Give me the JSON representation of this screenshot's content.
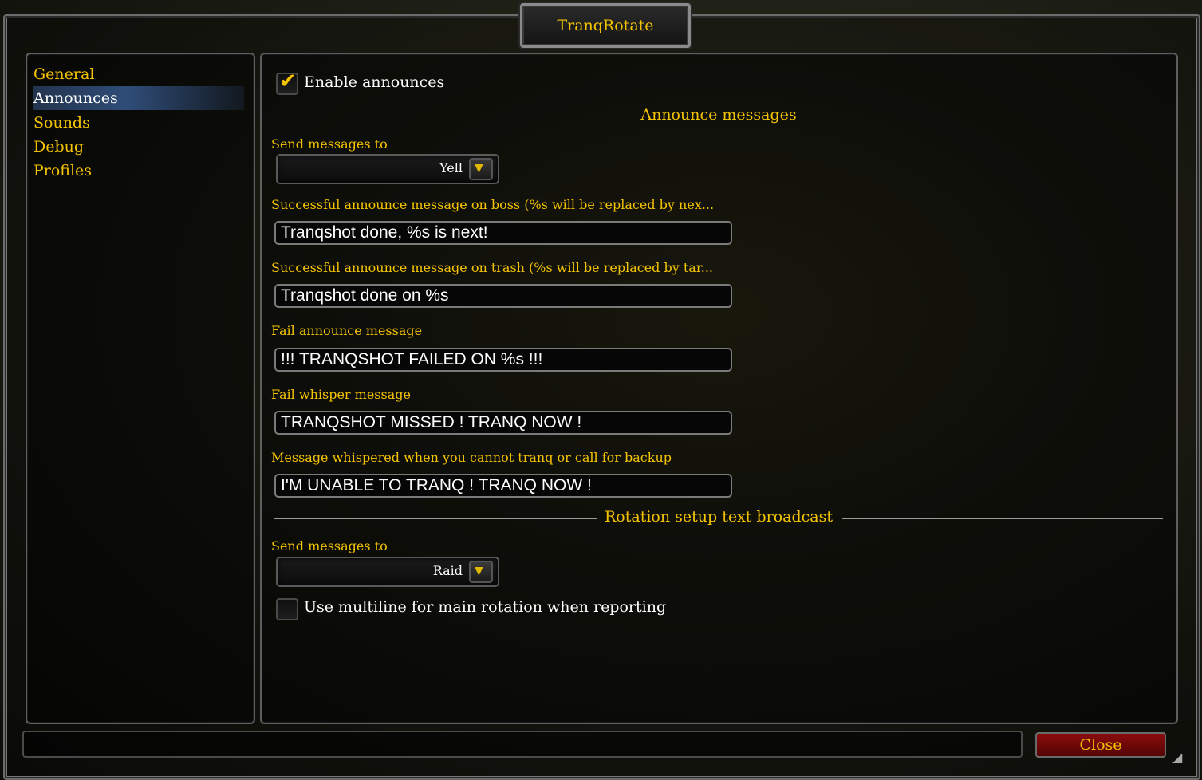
{
  "window": {
    "title": "TranqRotate"
  },
  "sidebar": {
    "items": [
      {
        "label": "General"
      },
      {
        "label": "Announces"
      },
      {
        "label": "Sounds"
      },
      {
        "label": "Debug"
      },
      {
        "label": "Profiles"
      }
    ],
    "selected": "Announces"
  },
  "announces": {
    "enable_label": "Enable announces",
    "enable_checked": true,
    "section1_heading": "Announce messages",
    "send_to_label": "Send messages to",
    "send_to_value": "Yell",
    "boss_label": "Successful announce message on boss (%s will be replaced by nex...",
    "boss_value": "Tranqshot done, %s is next!",
    "trash_label": "Successful announce message on trash (%s will be replaced by tar...",
    "trash_value": "Tranqshot done on %s",
    "fail_label": "Fail announce message",
    "fail_value": "!!! TRANQSHOT FAILED ON %s !!!",
    "fail_whisper_label": "Fail whisper message",
    "fail_whisper_value": "TRANQSHOT MISSED ! TRANQ NOW !",
    "unable_label": "Message whispered when you cannot tranq or call for backup",
    "unable_value": "I'M UNABLE TO TRANQ ! TRANQ NOW !",
    "section2_heading": "Rotation setup text broadcast",
    "send_to2_label": "Send messages to",
    "send_to2_value": "Raid",
    "multiline_label": "Use multiline for main rotation when reporting",
    "multiline_checked": false
  },
  "footer": {
    "close_label": "Close"
  },
  "colors": {
    "gold": "#f5c400",
    "selected_bg": "#2f4c78",
    "close_bg": "#8a0c0c"
  }
}
